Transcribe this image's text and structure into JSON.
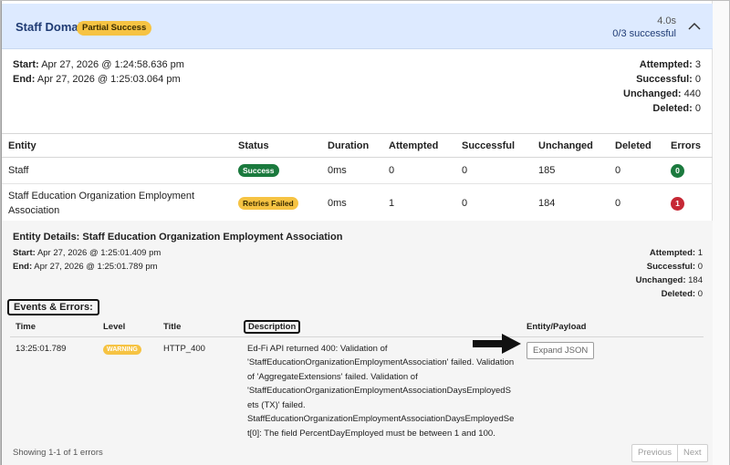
{
  "domain": {
    "title": "Staff Domain",
    "status_badge": "Partial Success",
    "duration": "4.0s",
    "successful_summary": "0/3 successful"
  },
  "summary": {
    "start_label": "Start:",
    "start_value": "Apr 27, 2026 @ 1:24:58.636 pm",
    "end_label": "End:",
    "end_value": "Apr 27, 2026 @ 1:25:03.064 pm",
    "attempted_label": "Attempted:",
    "attempted_value": "3",
    "successful_label": "Successful:",
    "successful_value": "0",
    "unchanged_label": "Unchanged:",
    "unchanged_value": "440",
    "deleted_label": "Deleted:",
    "deleted_value": "0"
  },
  "entity_table": {
    "headers": [
      "Entity",
      "Status",
      "Duration",
      "Attempted",
      "Successful",
      "Unchanged",
      "Deleted",
      "Errors"
    ],
    "rows": [
      {
        "entity": "Staff",
        "status": "Success",
        "duration": "0ms",
        "attempted": "0",
        "successful": "0",
        "unchanged": "185",
        "deleted": "0",
        "errors": "0"
      },
      {
        "entity": "Staff Education Organization Employment Association",
        "status": "Retries Failed",
        "duration": "0ms",
        "attempted": "1",
        "successful": "0",
        "unchanged": "184",
        "deleted": "0",
        "errors": "1"
      }
    ]
  },
  "details": {
    "title": "Entity Details: Staff Education Organization Employment Association",
    "start_label": "Start:",
    "start_value": "Apr 27, 2026 @ 1:25:01.409 pm",
    "end_label": "End:",
    "end_value": "Apr 27, 2026 @ 1:25:01.789 pm",
    "attempted_label": "Attempted:",
    "attempted_value": "1",
    "successful_label": "Successful:",
    "successful_value": "0",
    "unchanged_label": "Unchanged:",
    "unchanged_value": "184",
    "deleted_label": "Deleted:",
    "deleted_value": "0"
  },
  "events": {
    "section_label": "Events & Errors:",
    "headers": [
      "Time",
      "Level",
      "Title",
      "Description",
      "Entity/Payload"
    ],
    "rows": [
      {
        "time": "13:25:01.789",
        "level": "WARNING",
        "title": "HTTP_400",
        "description": "Ed-Fi API returned 400: Validation of 'StaffEducationOrganizationEmploymentAssociation' failed. Validation of 'AggregateExtensions' failed. Validation of 'StaffEducationOrganizationEmploymentAssociationDaysEmployedSets (TX)' failed. StaffEducationOrganizationEmploymentAssociationDaysEmployedSet[0]: The field PercentDayEmployed must be between 1 and 100.",
        "payload_button": "Expand JSON"
      }
    ]
  },
  "footer": {
    "showing_text": "Showing 1-1 of 1 errors",
    "previous_label": "Previous",
    "next_label": "Next"
  },
  "colors": {
    "header_bg": "#ddeaff",
    "title_blue": "#1f3b73",
    "success_green": "#1b7a3e",
    "warning_yellow": "#f6c343",
    "error_red": "#c62835"
  },
  "icons": {
    "collapse": "chevron-up-icon",
    "annotation_arrow": "arrow-right-icon"
  }
}
